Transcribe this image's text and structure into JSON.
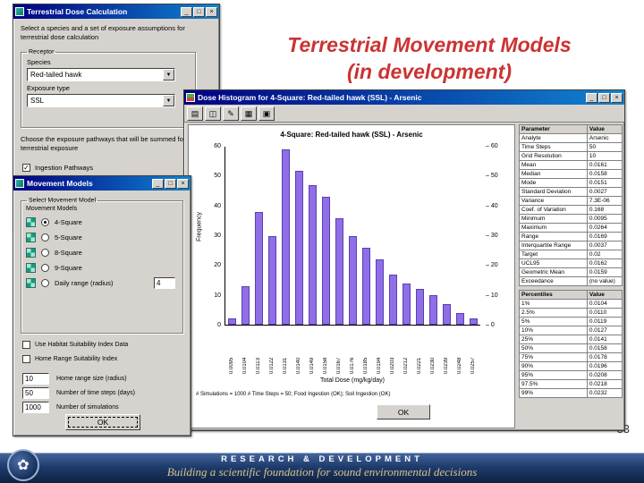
{
  "chrome": {
    "minimize": "_",
    "maximize": "□",
    "close": "×"
  },
  "slide": {
    "title_line1": "Terrestrial Movement Models",
    "title_line2": "(in development)",
    "page_number": "33"
  },
  "footer": {
    "banner_line1": "RESEARCH & DEVELOPMENT",
    "banner_line2": "Building a scientific foundation for sound environmental decisions",
    "logo_glyph": "✿"
  },
  "dose_window": {
    "title": "Terrestrial Dose Calculation",
    "intro_text": "Select a species and a set of exposure assumptions for terrestrial dose calculation",
    "receptor_group_label": "Receptor",
    "species_label": "Species",
    "species_value": "Red-tailed hawk",
    "exposure_type_label": "Exposure type",
    "exposure_type_value": "SSL",
    "pathways_text": "Choose the exposure pathways that will be summed for terrestrial exposure",
    "pathways_checkbox_label": "Ingestion Pathways",
    "pathways_checkbox_glyph": "✓"
  },
  "movement_window": {
    "title": "Movement Models",
    "group_label": "Select Movement Model",
    "models_label": "Movement Models",
    "model_options": [
      {
        "label": "4-Square",
        "selected": true
      },
      {
        "label": "5-Square",
        "selected": false
      },
      {
        "label": "8-Square",
        "selected": false
      },
      {
        "label": "9-Square",
        "selected": false
      },
      {
        "label": "Daily range (radius)",
        "selected": false
      }
    ],
    "daily_range_value": "4",
    "habitat_checkbox_label": "Use Habitat Suitability Index Data",
    "home_range_checkbox_label": "Home Range Suitability Index",
    "fields": [
      {
        "value": "10",
        "label": "Home range size (radius)"
      },
      {
        "value": "50",
        "label": "Number of time steps (days)"
      },
      {
        "value": "1000",
        "label": "Number of simulations"
      }
    ],
    "ok_label": "OK"
  },
  "histogram_window": {
    "title": "Dose Histogram for 4-Square: Red-tailed hawk (SSL) - Arsenic",
    "toolbar_icons": [
      {
        "name": "print-icon",
        "glyph": "▤"
      },
      {
        "name": "copy-icon",
        "glyph": "◫"
      },
      {
        "name": "edit-icon",
        "glyph": "✎"
      },
      {
        "name": "table-icon",
        "glyph": "▦"
      },
      {
        "name": "save-icon",
        "glyph": "▣"
      }
    ],
    "footnote": "# Simulations = 1000  # Time Steps = 50; Food Ingestion (OK); Soil Ingestion (OK)",
    "ok_label": "OK"
  },
  "chart_data": {
    "type": "bar",
    "title": "4-Square: Red-tailed hawk (SSL) - Arsenic",
    "xlabel": "Total Dose (mg/kg/day)",
    "ylabel": "Frequency",
    "ylim": [
      0,
      60
    ],
    "yticks": [
      0,
      10,
      20,
      30,
      40,
      50,
      60
    ],
    "grid": false,
    "legend": null,
    "bar_color": "#8f6ee8",
    "bar_border_color": "#5b3fae",
    "categories": [
      "0.0095",
      "0.0104",
      "0.0113",
      "0.0122",
      "0.0131",
      "0.0140",
      "0.0149",
      "0.0158",
      "0.0167",
      "0.0176",
      "0.0185",
      "0.0194",
      "0.0203",
      "0.0212",
      "0.0221",
      "0.0230",
      "0.0239",
      "0.0248",
      "0.0257"
    ],
    "values": [
      2,
      13,
      38,
      30,
      59,
      52,
      47,
      43,
      36,
      30,
      26,
      22,
      17,
      14,
      12,
      10,
      7,
      4,
      2
    ]
  },
  "stats_table": {
    "headers": [
      "Parameter",
      "Value"
    ],
    "rows": [
      [
        "Analyte",
        "Arsenic"
      ],
      [
        "Time Steps",
        "50"
      ],
      [
        "Grid Resolution",
        "10"
      ],
      [
        "Mean",
        "0.0161"
      ],
      [
        "Median",
        "0.0158"
      ],
      [
        "Mode",
        "0.0151"
      ],
      [
        "Standard Deviation",
        "0.0027"
      ],
      [
        "Variance",
        "7.3E-06"
      ],
      [
        "Coef. of Variation",
        "0.168"
      ],
      [
        "Minimum",
        "0.0095"
      ],
      [
        "Maximum",
        "0.0264"
      ],
      [
        "Range",
        "0.0169"
      ],
      [
        "Interquartile Range",
        "0.0037"
      ],
      [
        "Target",
        "0.02"
      ],
      [
        "UCL95",
        "0.0162"
      ],
      [
        "Geometric Mean",
        "0.0159"
      ],
      [
        "Exceedance",
        "(no value)"
      ]
    ]
  },
  "percentiles_table": {
    "headers": [
      "Percentiles",
      "Value"
    ],
    "rows": [
      [
        "1%",
        "0.0104"
      ],
      [
        "2.5%",
        "0.0110"
      ],
      [
        "5%",
        "0.0119"
      ],
      [
        "10%",
        "0.0127"
      ],
      [
        "25%",
        "0.0141"
      ],
      [
        "50%",
        "0.0158"
      ],
      [
        "75%",
        "0.0178"
      ],
      [
        "90%",
        "0.0196"
      ],
      [
        "95%",
        "0.0208"
      ],
      [
        "97.5%",
        "0.0218"
      ],
      [
        "99%",
        "0.0232"
      ]
    ]
  }
}
